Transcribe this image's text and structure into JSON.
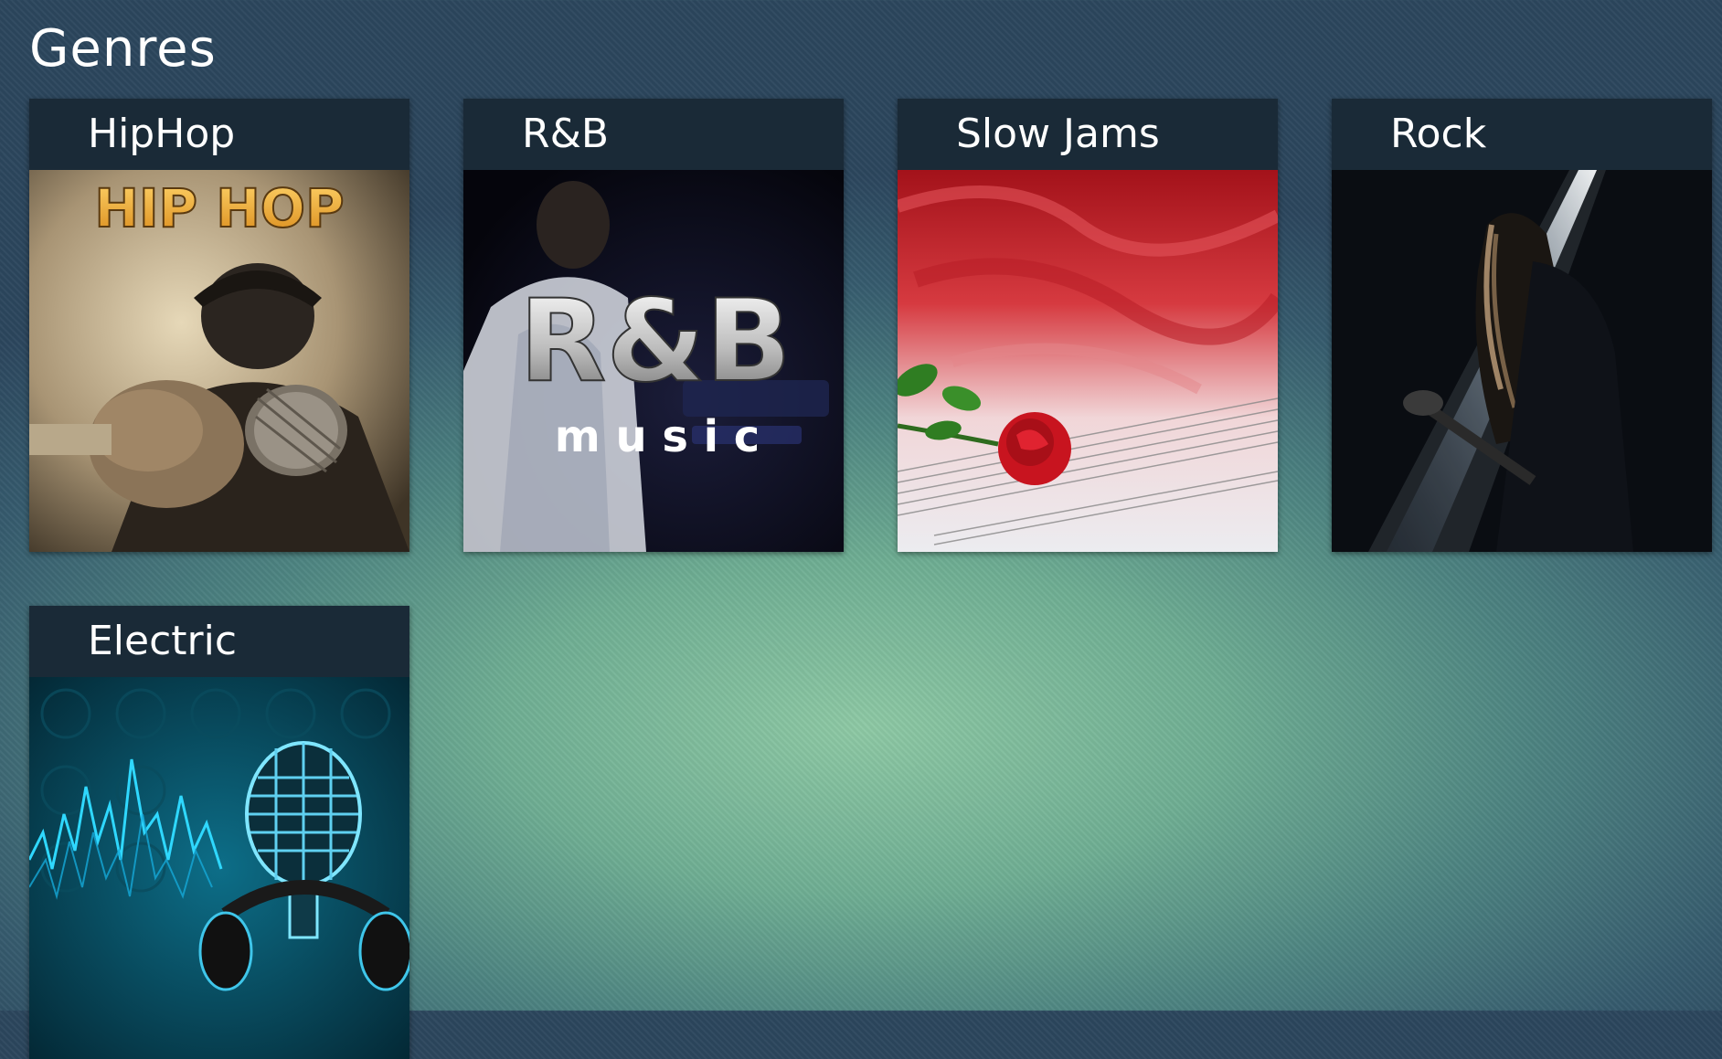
{
  "page": {
    "title": "Genres"
  },
  "genres": [
    {
      "label": "HipHop",
      "art_text": "HIP HOP",
      "art_icon": "microphone-fist-icon"
    },
    {
      "label": "R&B",
      "art_text": "R&B",
      "art_subtext": "m u s i c",
      "art_icon": "singer-icon"
    },
    {
      "label": "Slow Jams",
      "art_icon": "rose-sheet-music-icon"
    },
    {
      "label": "Rock",
      "art_icon": "guitarist-spotlight-icon"
    },
    {
      "label": "Electric",
      "art_icon": "microphone-headphones-icon"
    }
  ],
  "colors": {
    "tile_header": "#1a2a37",
    "title_text": "#ffffff",
    "background_center": "#8ec9a5",
    "background_edge": "#2c465d"
  }
}
